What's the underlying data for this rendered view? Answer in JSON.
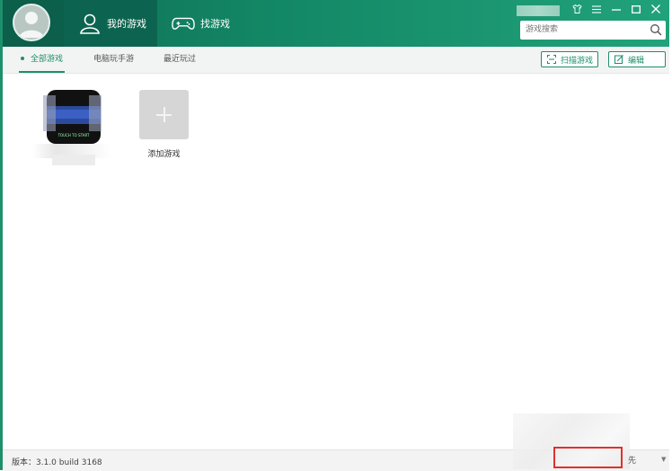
{
  "header": {
    "tabs": [
      {
        "label": "我的游戏",
        "icon": "user-icon",
        "active": true
      },
      {
        "label": "找游戏",
        "icon": "gamepad-icon",
        "active": false
      }
    ],
    "search": {
      "placeholder": "游戏搜索"
    },
    "window_controls": [
      "shirt-icon",
      "menu-icon",
      "minimize-icon",
      "maximize-icon",
      "close-icon"
    ]
  },
  "subnav": {
    "tabs": [
      {
        "label": "全部游戏",
        "active": true
      },
      {
        "label": "电脑玩手游",
        "active": false
      },
      {
        "label": "最近玩过",
        "active": false
      }
    ],
    "actions": {
      "scan_label": "扫描游戏",
      "edit_label": "编辑"
    }
  },
  "games": {
    "add_label": "添加游戏",
    "card_mini_text": "TOUCH TO START"
  },
  "status": {
    "version": "版本：3.1.0 build 3168",
    "priority_label": "先"
  },
  "colors": {
    "accent": "#1e8f6b",
    "header_dark": "#0c6450",
    "highlight": "#e0312d"
  }
}
